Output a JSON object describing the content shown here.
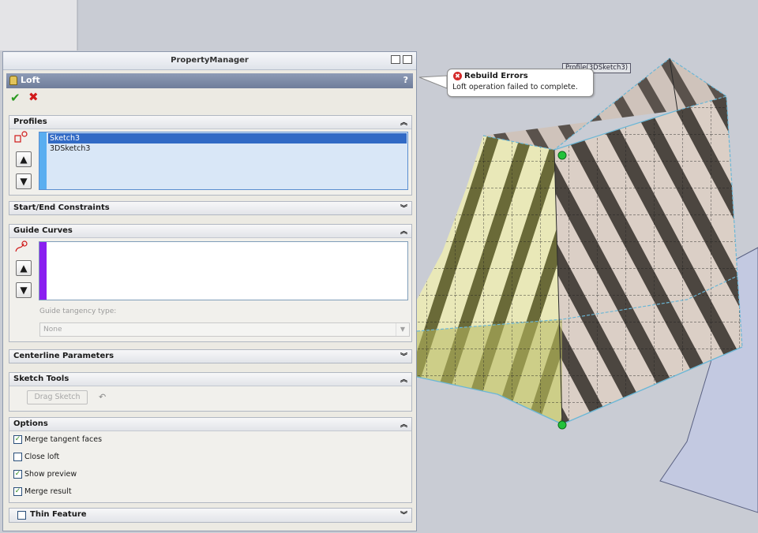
{
  "panel": {
    "header_title": "PropertyManager",
    "feature_name": "Loft",
    "help": "?"
  },
  "icons": {
    "ok": "✔",
    "cancel": "✖",
    "up": "🡅",
    "down": "🡇",
    "expanded": "≈",
    "collapsed": "¥",
    "error": "✖",
    "undo": "↶"
  },
  "profiles": {
    "title": "Profiles",
    "items": [
      "Sketch3",
      "3DSketch3"
    ],
    "selected_index": 0,
    "strip_color": "#5aaef0"
  },
  "start_end": {
    "title": "Start/End Constraints"
  },
  "guide_curves": {
    "title": "Guide Curves",
    "strip_color": "#8a1ff0",
    "tangency_label": "Guide tangency type:",
    "tangency_value": "None"
  },
  "centerline": {
    "title": "Centerline Parameters"
  },
  "sketch_tools": {
    "title": "Sketch Tools",
    "drag_sketch": "Drag Sketch"
  },
  "options": {
    "title": "Options",
    "merge_tangent": {
      "label": "Merge tangent faces",
      "checked": true
    },
    "close_loft": {
      "label": "Close loft",
      "checked": false
    },
    "show_preview": {
      "label": "Show preview",
      "checked": true
    },
    "merge_result": {
      "label": "Merge result",
      "checked": true
    }
  },
  "thin_feature": {
    "label": "Thin Feature",
    "checked": false
  },
  "callout": {
    "title": "Rebuild Errors",
    "message": "Loft operation failed to complete."
  },
  "profile_tag": "Profile(3DSketch3)"
}
